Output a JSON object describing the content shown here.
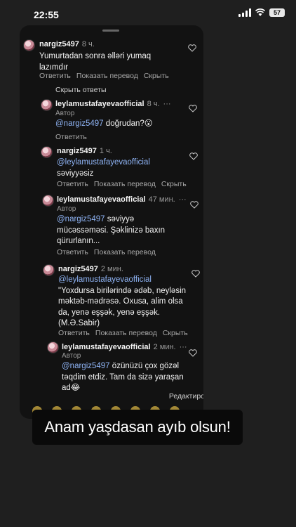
{
  "status_bar": {
    "time": "22:55",
    "battery": "57"
  },
  "comments": [
    {
      "username": "nargiz5497",
      "time": "8 ч.",
      "text": "Yumurtadan sonra əlləri yumaq lazımdır",
      "actions": [
        "Ответить",
        "Показать перевод",
        "Скрыть"
      ]
    },
    {
      "username": "leylamustafayevaofficial",
      "time": "8 ч.",
      "author": "Автор",
      "mention": "@nargiz5497",
      "text": "doğrudan?😮",
      "actions": [
        "Ответить"
      ]
    },
    {
      "username": "nargiz5497",
      "time": "1 ч.",
      "mention": "@leylamustafayevaofficial",
      "text": "səviyyəsiz",
      "actions": [
        "Ответить",
        "Показать перевод",
        "Скрыть"
      ]
    },
    {
      "username": "leylamustafayevaofficial",
      "time": "47 мин.",
      "author": "Автор",
      "mention": "@nargiz5497",
      "text": "səviyyə mücəssəməsi. Şəklinizə baxın qürurlanın...",
      "actions": [
        "Ответить",
        "Показать перевод"
      ]
    },
    {
      "username": "nargiz5497",
      "time": "2 мин.",
      "mention": "@leylamustafayevaofficial",
      "text": "\"Yoxdursa birilərində ədəb, neyləsin məktəb-mədrəsə. Oxusa, alim olsa da, yenə eşşək, yenə eşşək. (M.Ə.Sabir)",
      "actions": [
        "Ответить",
        "Показать перевод",
        "Скрыть"
      ]
    },
    {
      "username": "leylamustafayevaofficial",
      "time": "2 мин.",
      "author": "Автор",
      "mention": "@nargiz5497",
      "text": "özünüzü çox gözəl təqdim etdiz. Tam da sizə yaraşan ad😂",
      "actions": []
    }
  ],
  "hide_replies": "Скрыть ответы",
  "edit_label": "Редактиро",
  "caption": "Anam yaşdasan ayıb olsun!"
}
